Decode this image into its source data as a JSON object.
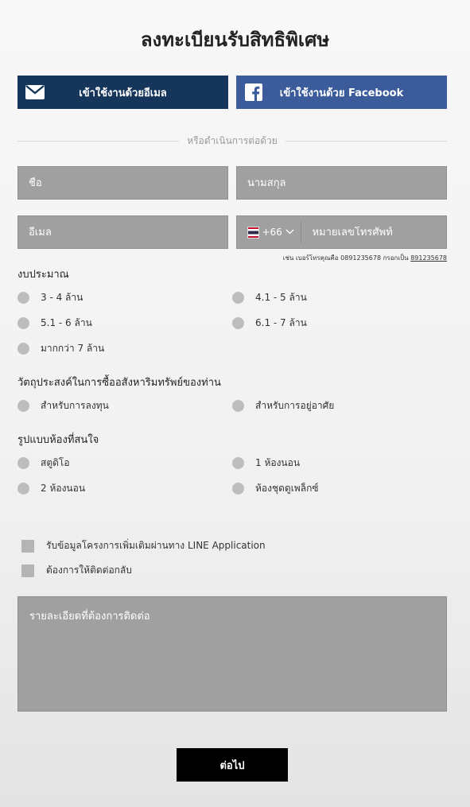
{
  "title": "ลงทะเบียนรับสิทธิพิเศษ",
  "social": {
    "email_label": "เข้าใช้งานด้วยอีเมล",
    "facebook_label": "เข้าใช้งานด้วย Facebook"
  },
  "divider_text": "หรือดำเนินการต่อด้วย",
  "fields": {
    "first_name": "ชื่อ",
    "last_name": "นามสกุล",
    "email": "อีเมล",
    "country_code": "+66",
    "phone": "หมายเลขโทรศัพท์"
  },
  "phone_hint": {
    "text": "เช่น เบอร์โทรคุณคือ 0891235678 กรอกเป็น ",
    "example": "891235678"
  },
  "budget": {
    "title": "งบประมาณ",
    "options": [
      "3 - 4 ล้าน",
      "4.1 - 5 ล้าน",
      "5.1 - 6 ล้าน",
      "6.1 - 7 ล้าน",
      "มากกว่า 7 ล้าน"
    ]
  },
  "purpose": {
    "title": "วัตถุประสงค์ในการซื้ออสังหาริมทรัพย์ของท่าน",
    "options": [
      "สำหรับการลงทุน",
      "สำหรับการอยู่อาศัย"
    ]
  },
  "room_type": {
    "title": "รูปแบบห้องที่สนใจ",
    "options": [
      "สตูดิโอ",
      "1 ห้องนอน",
      "2 ห้องนอน",
      "ห้องชุดดูเพล็กซ์"
    ]
  },
  "checkboxes": [
    "รับข้อมูลโครงการเพิ่มเติมผ่านทาง LINE Application",
    "ต้องการให้ติดต่อกลับ"
  ],
  "details_placeholder": "รายละเอียดที่ต้องการติดต่อ",
  "next_label": "ต่อไป",
  "colors": {
    "email_btn": "#16355b",
    "facebook_btn": "#3b5b9b",
    "field_bg": "#a0a0a0",
    "next_btn": "#000000"
  }
}
